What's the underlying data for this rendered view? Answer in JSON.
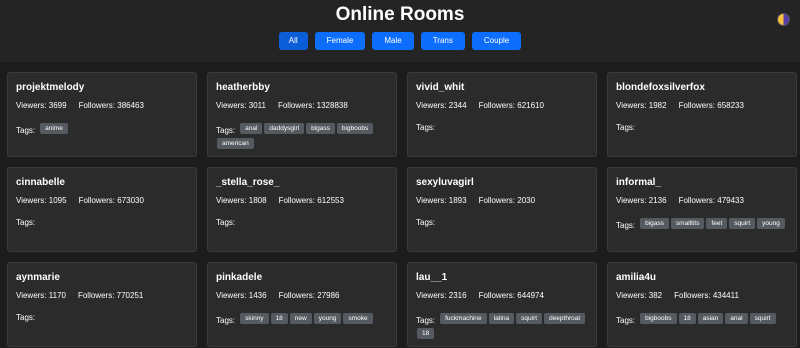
{
  "header": {
    "title": "Online Rooms",
    "filters": [
      {
        "label": "All",
        "active": true
      },
      {
        "label": "Female",
        "active": false
      },
      {
        "label": "Male",
        "active": false
      },
      {
        "label": "Trans",
        "active": false
      },
      {
        "label": "Couple",
        "active": false
      }
    ],
    "theme_icon": "half-moon-icon"
  },
  "labels": {
    "viewers": "Viewers:",
    "followers": "Followers:",
    "tags": "Tags:"
  },
  "colors": {
    "filter_button": "#0d6efd",
    "filter_button_active": "#0b5ed7",
    "tag_background": "#555a60",
    "card_background": "#2b2b2b"
  },
  "rooms": [
    {
      "name": "projektmelody",
      "viewers": "3699",
      "followers": "386463",
      "tags": [
        "anime"
      ]
    },
    {
      "name": "heatherbby",
      "viewers": "3011",
      "followers": "1328838",
      "tags": [
        "anal",
        "daddysgirl",
        "bigass",
        "bigboobs",
        "american"
      ]
    },
    {
      "name": "vivid_whit",
      "viewers": "2344",
      "followers": "621610",
      "tags": []
    },
    {
      "name": "blondefoxsilverfox",
      "viewers": "1982",
      "followers": "658233",
      "tags": []
    },
    {
      "name": "cinnabelle",
      "viewers": "1095",
      "followers": "673030",
      "tags": []
    },
    {
      "name": "_stella_rose_",
      "viewers": "1808",
      "followers": "612553",
      "tags": []
    },
    {
      "name": "sexyluvagirl",
      "viewers": "1893",
      "followers": "2030",
      "tags": []
    },
    {
      "name": "informal_",
      "viewers": "2136",
      "followers": "479433",
      "tags": [
        "bigass",
        "smalltits",
        "feet",
        "squirt",
        "young"
      ]
    },
    {
      "name": "aynmarie",
      "viewers": "1170",
      "followers": "770251",
      "tags": []
    },
    {
      "name": "pinkadele",
      "viewers": "1436",
      "followers": "27986",
      "tags": [
        "skinny",
        "18",
        "new",
        "young",
        "smoke"
      ]
    },
    {
      "name": "lau__1",
      "viewers": "2316",
      "followers": "644974",
      "tags": [
        "fuckmachine",
        "latina",
        "squirt",
        "deepthroat",
        "18"
      ]
    },
    {
      "name": "amilia4u",
      "viewers": "382",
      "followers": "434411",
      "tags": [
        "bigboobs",
        "18",
        "asian",
        "anal",
        "squirt"
      ]
    }
  ]
}
